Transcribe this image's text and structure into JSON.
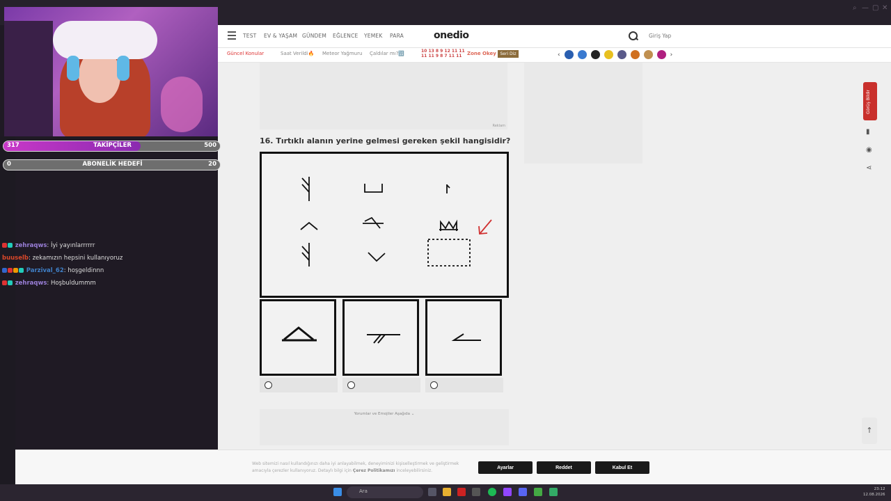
{
  "nav": {
    "items": [
      "TEST",
      "EV & YAŞAM",
      "GÜNDEM",
      "EĞLENCE",
      "YEMEK",
      "PARA"
    ],
    "logo": "onedio",
    "login": "Giriş Yap"
  },
  "trending": {
    "label": "Güncel Konular",
    "items": [
      "Saat Verildi🔥",
      "Meteor Yağmuru",
      "Çaldılar mı?🔢"
    ],
    "zone": "Zone Okey",
    "seriz": "Seri Diz",
    "numbers_top": "10 13  8  9 12 11 11",
    "numbers_bottom": "11 11  9  8  7 11 11"
  },
  "ad_label": "Reklam",
  "question": "16. Tırtıklı alanın yerine gelmesi gereken şekil hangisidir?",
  "comments_bar": "Yorumlar ve Emojiler Aşağıda ⌄",
  "feedback_tab": "Görüş Bildir",
  "cookie": {
    "text": "Web sitemizi nasıl kullandığınızı daha iyi anlayabilmek, deneyiminizi kişiselleştirmek ve geliştirmek amacıyla çerezler kullanıyoruz. Detaylı bilgi için",
    "link": "Çerez Politikamızı",
    "text_after": "inceleyebilirsiniz.",
    "settings": "Ayarlar",
    "reject": "Reddet",
    "accept": "Kabul Et"
  },
  "overlay": {
    "followers": {
      "current": "317",
      "label": "TAKİPÇİLER",
      "target": "500",
      "progress": 0.634
    },
    "subs": {
      "current": "0",
      "label": "ABONELİK HEDEFİ",
      "target": "20",
      "progress": 0.0
    }
  },
  "chat": [
    {
      "user": "zehraqws",
      "msg": ": İyi yayınlarrrrrr",
      "color": "#9a7fd8"
    },
    {
      "user": "buuselb",
      "msg": ": zekamızın hepsini kullanıyoruz",
      "color": "#d9482a"
    },
    {
      "user": "Parzival_62",
      "msg": ": hoşgeldinnn",
      "color": "#3f7fc6"
    },
    {
      "user": "zehraqws",
      "msg": ": Hoşbuldummm",
      "color": "#9a7fd8"
    }
  ],
  "taskbar": {
    "search": "Ara",
    "time": "23:12",
    "date": "12.08.2026"
  },
  "colors": {
    "accent_red": "#c9302c",
    "button_dark": "#1a1a1a",
    "goal_purple": "#c838c8"
  }
}
